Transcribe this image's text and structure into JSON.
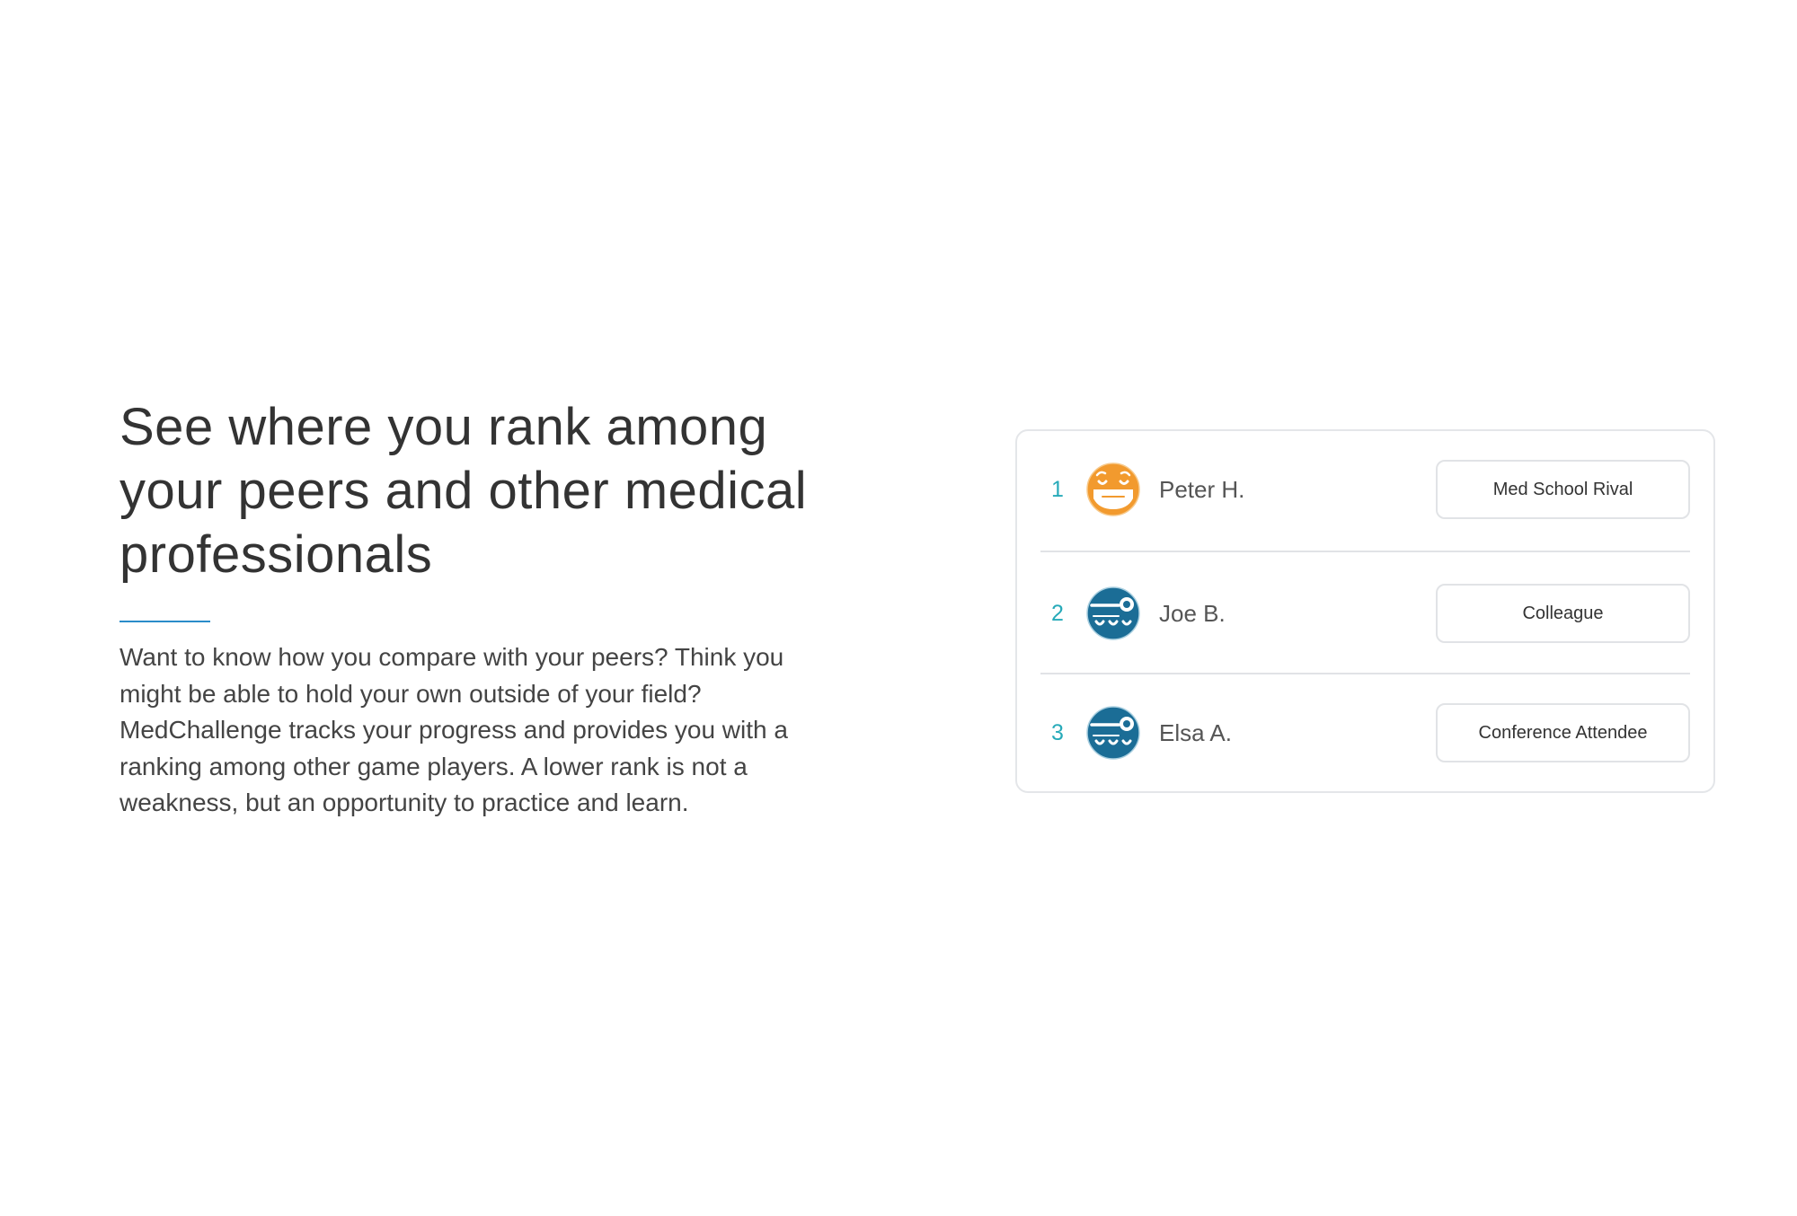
{
  "section": {
    "headline": "See where you rank among your peers and other medical professionals",
    "description": "Want to know how you compare with your peers? Think you might be able to hold your own outside of your field? MedChallenge tracks your progress and provides you with a ranking among other game players. A lower rank is not a weakness, but an opportunity to practice and learn."
  },
  "leaderboard": {
    "rows": [
      {
        "rank": "1",
        "name": "Peter H.",
        "tag": "Med School Rival",
        "avatar_icon": "surgeon-mask-avatar-icon",
        "avatar_color": "#f29a2e"
      },
      {
        "rank": "2",
        "name": "Joe B.",
        "tag": "Colleague",
        "avatar_icon": "head-mirror-doctor-avatar-icon",
        "avatar_color": "#1b6d96"
      },
      {
        "rank": "3",
        "name": "Elsa A.",
        "tag": "Conference Attendee",
        "avatar_icon": "head-mirror-doctor-avatar-icon",
        "avatar_color": "#1b6d96"
      }
    ]
  },
  "colors": {
    "accent_rule": "#2a8cc9",
    "rank_number": "#27aab9",
    "avatar_orange": "#f29a2e",
    "avatar_blue": "#1b6d96"
  }
}
